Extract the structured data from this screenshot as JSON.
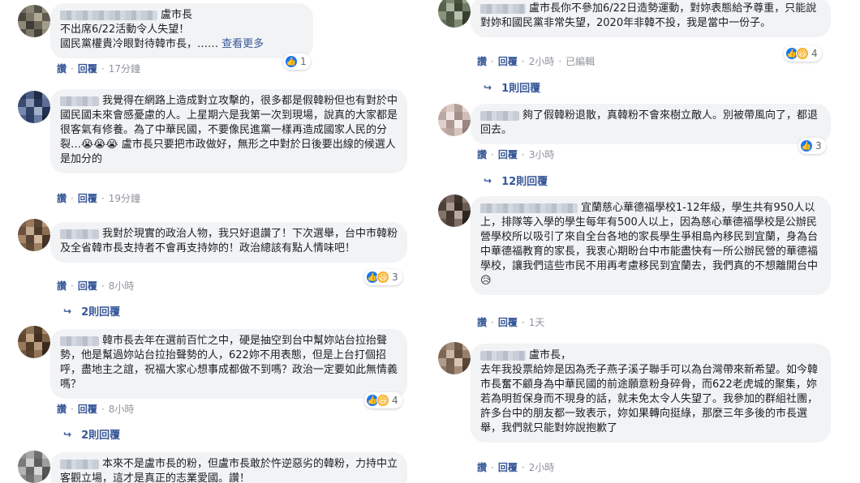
{
  "colors": {
    "link": "#385898",
    "bubble": "#f2f3f5",
    "like": "#1877f2",
    "haha": "#f7b125"
  },
  "actions": {
    "like": "讚",
    "reply": "回覆",
    "dot": "·"
  },
  "left": [
    {
      "text": "盧市長\n不出席6/22活動令人失望！\n國民黨權貴冷眼對待韓市長，…… ",
      "see_more": "查看更多",
      "reactions": "1",
      "time": "17分鐘"
    },
    {
      "text": "我覺得在網路上造成對立攻擊的，很多都是假韓粉但也有對於中國民國未來會感憂慮的人。上星期六是我第一次到現場，說真的大家都是很客氣有修養。為了中華民國，不要像民進黨一樣再造成國家人民的分裂…😭😭😭 盧市長只要把市政做好，無形之中對於日後要出線的候選人是加分的",
      "time": "19分鐘"
    },
    {
      "text": "我對於現實的政治人物，我只好退讚了！下次選舉，台中市韓粉及全省韓市長支持者不會再支持妳的！政治總該有點人情味吧！",
      "reactions": "3",
      "time": "8小時",
      "replies": "2則回覆"
    },
    {
      "text": "韓市長去年在選前百忙之中，硬是抽空到台中幫妳站台拉抬聲勢，他是幫過妳站台拉抬聲勢的人，622妳不用表態，但是上台打個招呼，盡地主之誼，祝福大家心想事成都做不到嗎？政治一定要如此無情義嗎？",
      "reactions": "4",
      "time": "8小時",
      "replies": "2則回覆"
    },
    {
      "text": "本來不是盧市長的粉，但盧市長敢於忤逆惡劣的韓粉，力持中立客觀立場，這才是真正的志業愛國。讚！"
    }
  ],
  "right": [
    {
      "text": "盧市長你不參加6/22日造勢運動，對妳表態給予尊重，只能說對妳和國民黨非常失望，2020年非韓不投，我是當中一份子。",
      "reactions": "4",
      "time": "2小時",
      "edited": "已編輯",
      "replies": "1則回覆"
    },
    {
      "text": "夠了假韓粉退散，真韓粉不會來樹立敵人。別被帶風向了，都退回去。",
      "reactions": "3",
      "time": "3小時",
      "replies": "12則回覆"
    },
    {
      "text": "宜蘭慈心華德福學校1-12年級，學生共有950人以上，排隊等入學的學生每年有500人以上，因為慈心華德福學校是公辦民營學校所以吸引了來自全台各地的家長學生爭相島內移民到宜蘭，身為台中華德福教育的家長，我衷心期盼台中市能盡快有一所公辦民營的華德福學校，讓我們這些市民不用再考慮移民到宜蘭去，我們真的不想離開台中😥",
      "time": "1天"
    },
    {
      "text": "盧市長，\n去年我投票給妳是因為禿子燕子溪子聯手可以為台灣帶來新希望。如今韓市長奮不顧身為中華民國的前途願意粉身碎骨，而622老虎城的聚集，妳若為明哲保身而不現身的話，就未免太令人失望了。我參加的群組社團，許多台中的朋友都一致表示，妳如果轉向挺綠，那麼三年多後的市長選舉，我們就只能對妳說抱歉了",
      "time": "2小時"
    }
  ]
}
